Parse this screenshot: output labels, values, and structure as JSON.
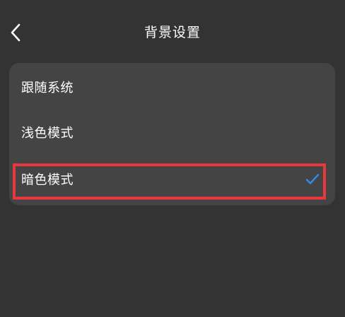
{
  "header": {
    "title": "背景设置",
    "back_icon": "chevron-left-icon"
  },
  "options": [
    {
      "label": "跟随系统",
      "selected": false
    },
    {
      "label": "浅色模式",
      "selected": false
    },
    {
      "label": "暗色模式",
      "selected": true
    }
  ],
  "colors": {
    "background": "#333333",
    "card": "#444444",
    "text": "#ffffff",
    "check": "#2f8df5",
    "highlight_border": "#e8383d"
  },
  "icons": {
    "check": "check-icon"
  }
}
